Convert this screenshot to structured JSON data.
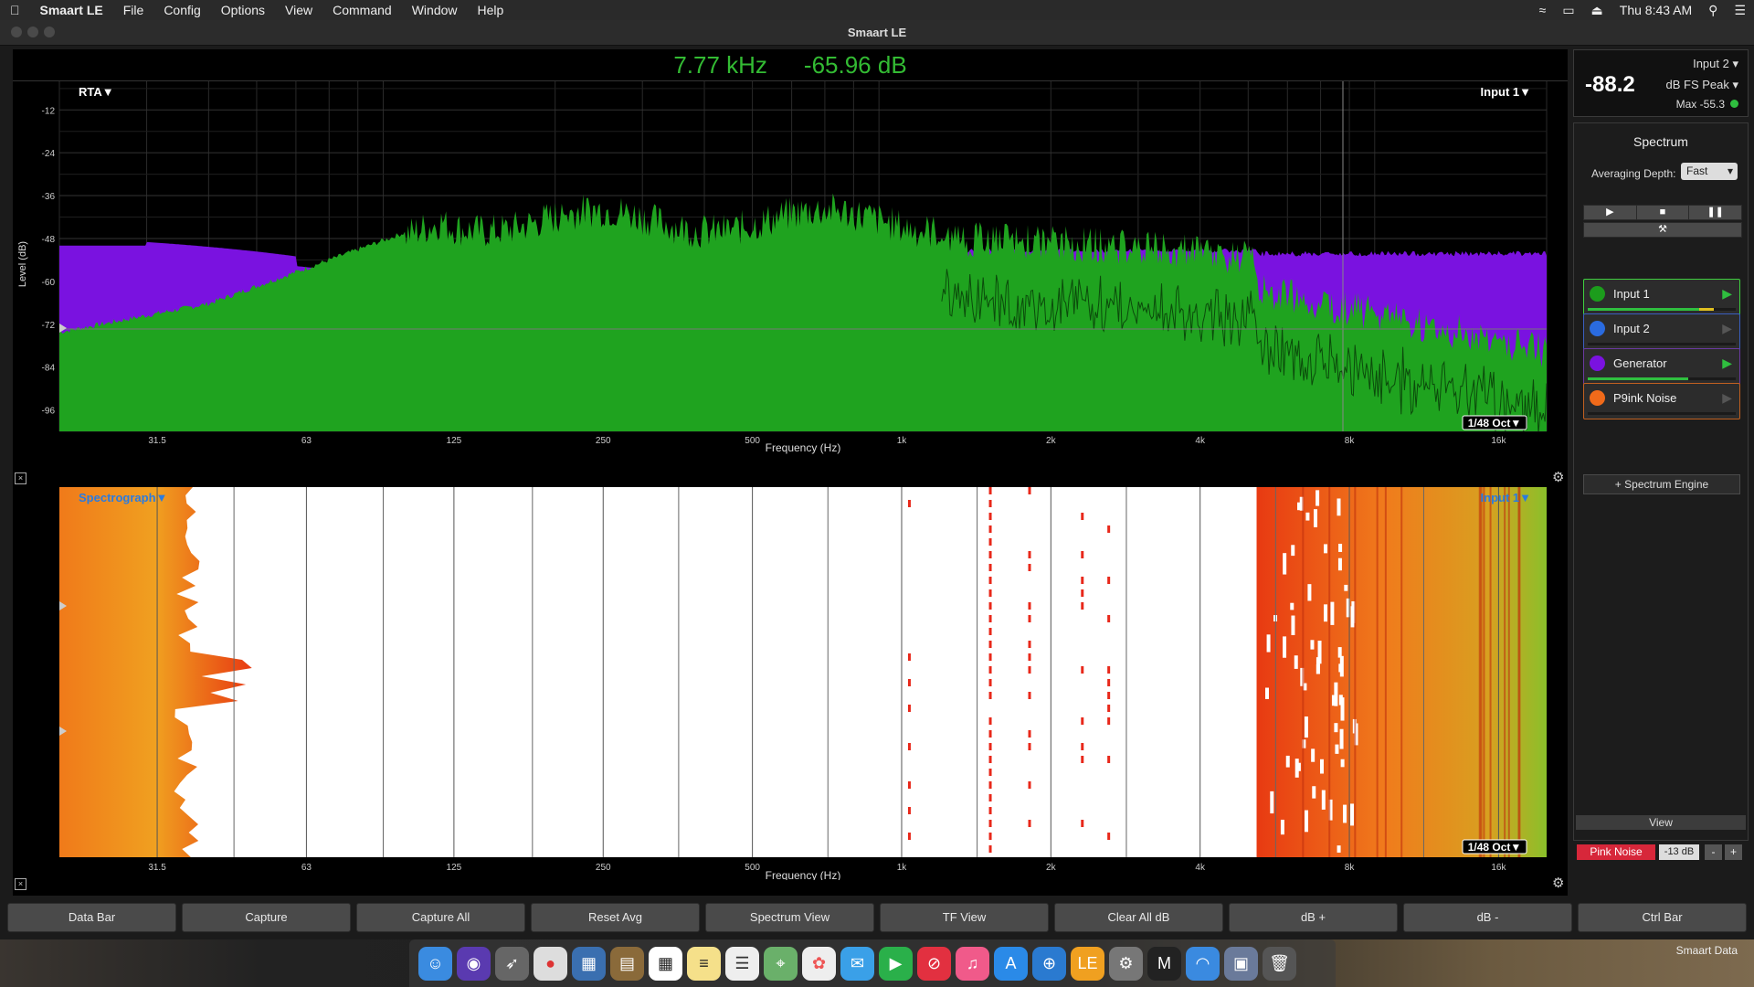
{
  "menubar": {
    "apple": "",
    "app_name": "Smaart LE",
    "items": [
      "File",
      "Config",
      "Options",
      "View",
      "Command",
      "Window",
      "Help"
    ],
    "clock": "Thu 8:43 AM"
  },
  "window": {
    "title": "Smaart LE"
  },
  "readout": {
    "frequency": "7.77 kHz",
    "level": "-65.96 dB"
  },
  "rta": {
    "mode_label": "RTA▼",
    "input_label": "Input 1▼",
    "ylabel": "Level (dB)",
    "xlabel": "Frequency (Hz)",
    "y_ticks": [
      "-12",
      "-24",
      "-36",
      "-48",
      "-60",
      "-72",
      "-84",
      "-96"
    ],
    "x_ticks": [
      "31.5",
      "63",
      "125",
      "250",
      "500",
      "1k",
      "2k",
      "4k",
      "8k",
      "16k"
    ],
    "resolution": "1/48 Oct▼",
    "colors": {
      "input1": "#1fa31f",
      "generator": "#7a12e0"
    }
  },
  "spectrograph": {
    "mode_label": "Spectrograph▼",
    "input_label": "Input 1▼",
    "xlabel": "Frequency (Hz)",
    "x_ticks": [
      "31.5",
      "63",
      "125",
      "250",
      "500",
      "1k",
      "2k",
      "4k",
      "8k",
      "16k"
    ],
    "resolution": "1/48 Oct▼"
  },
  "meter": {
    "input": "Input 2",
    "value": "-88.2",
    "unit": "dB FS Peak",
    "max": "Max -55.3"
  },
  "spectrum": {
    "title": "Spectrum",
    "averaging_label": "Averaging Depth:",
    "averaging_value": "Fast",
    "sources": [
      {
        "name": "Input 1",
        "color": "#1c9c1c",
        "border": "#3fcf3f",
        "level": 0.75
      },
      {
        "name": "Input 2",
        "color": "#2a6be0",
        "border": "#3a5fc0",
        "level": 0
      },
      {
        "name": "Generator",
        "color": "#7a12e0",
        "border": "#6a3aa0",
        "level": 0.68
      },
      {
        "name": "P9ink Noise",
        "color": "#f06a1a",
        "border": "#c06020",
        "level": 0
      }
    ],
    "engine_button": "+ Spectrum Engine",
    "view_button": "View"
  },
  "generator": {
    "signal": "Pink Noise",
    "gain": "-13 dB",
    "minus": "-",
    "plus": "+"
  },
  "bottom_buttons": [
    "Data Bar",
    "Capture",
    "Capture All",
    "Reset Avg",
    "Spectrum View",
    "TF View",
    "Clear All dB",
    "dB +",
    "dB -",
    "Ctrl Bar"
  ],
  "dock": {
    "label": "Smaart Data"
  }
}
